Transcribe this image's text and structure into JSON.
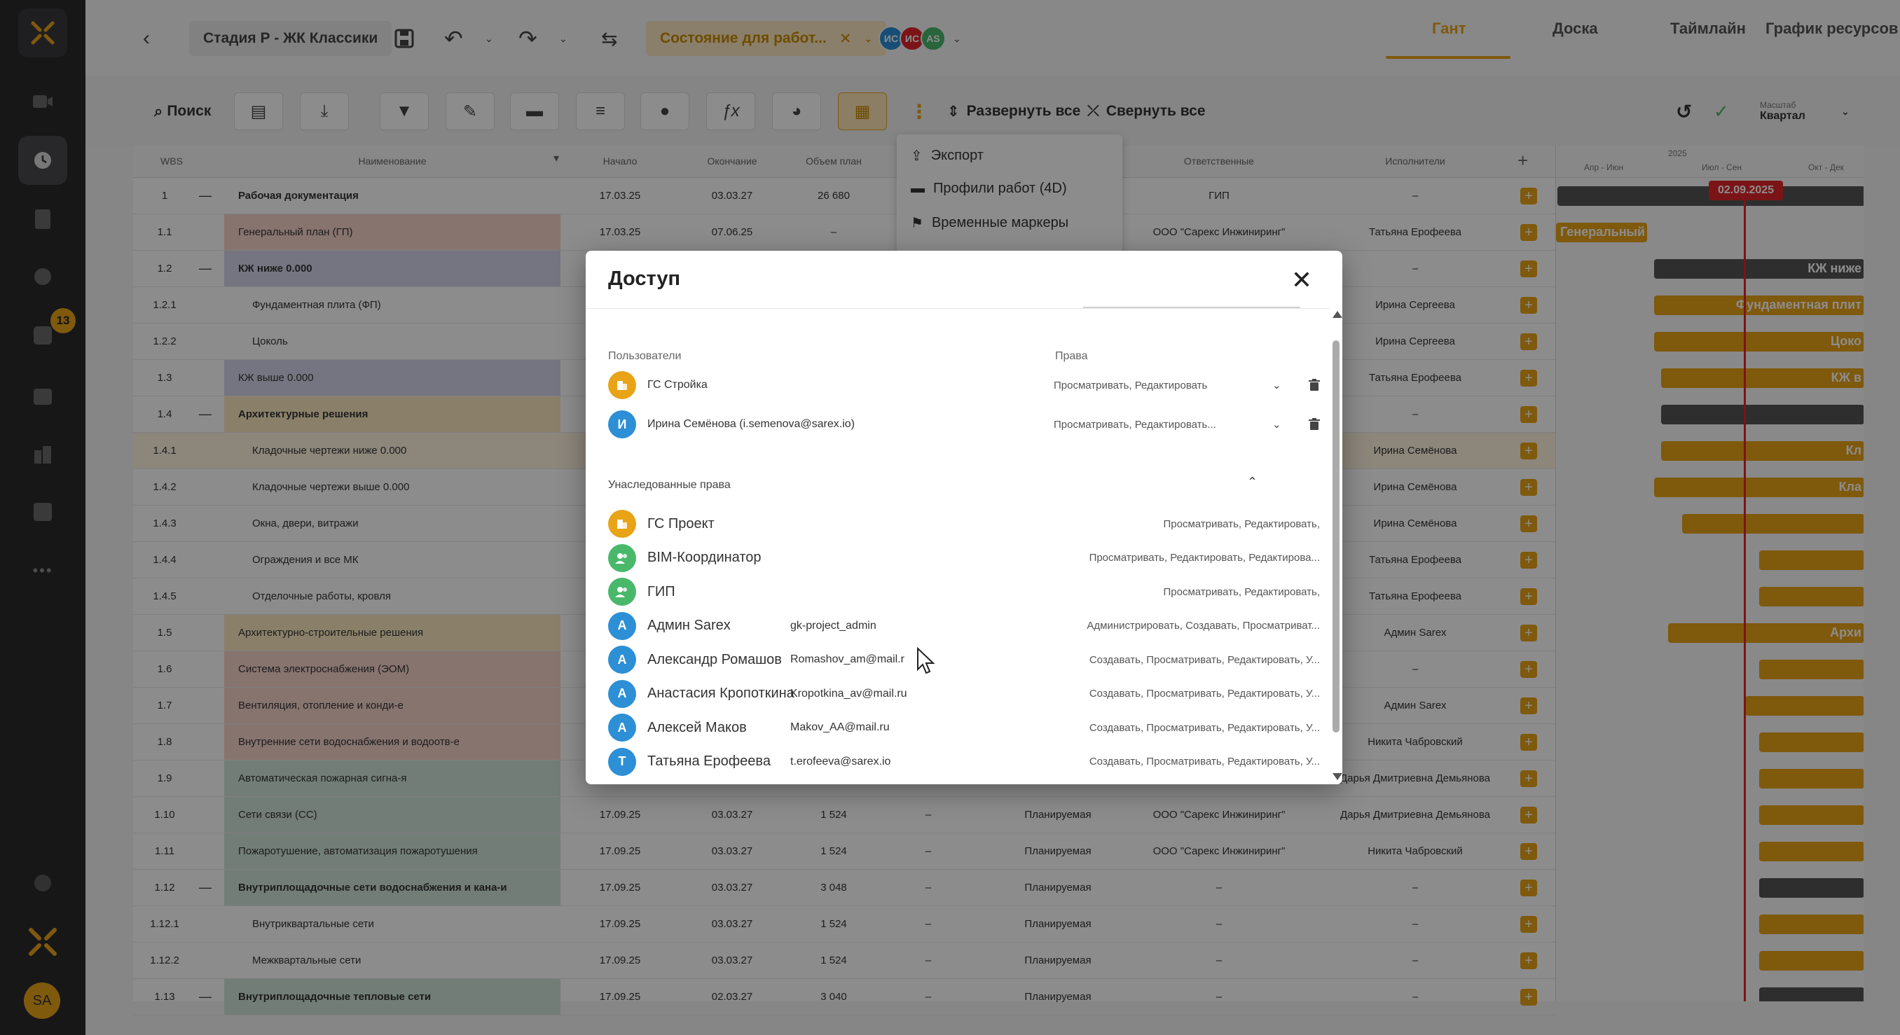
{
  "sidebar": {
    "badge": "13",
    "avatar": "SA"
  },
  "header": {
    "back_icon": "chevron-left-icon",
    "stage": "Стадия Р - ЖК Классики",
    "state_filter": "Состояние для работ...",
    "avatars": [
      {
        "initials": "ИС",
        "color": "#2d8fd5"
      },
      {
        "initials": "ИС",
        "color": "#e0262b"
      },
      {
        "initials": "AS",
        "color": "#49b86a"
      }
    ],
    "tabs": [
      "Гант",
      "Доска",
      "Таймлайн",
      "График ресурсов"
    ]
  },
  "toolbar": {
    "search": "Поиск",
    "expand_all": "Развернуть все",
    "collapse_all": "Свернуть все",
    "scale_label": "Масштаб",
    "scale_value": "Квартал"
  },
  "grid": {
    "headers": {
      "wbs": "WBS",
      "name": "Наименование",
      "start": "Начало",
      "end": "Окончание",
      "volume": "Объем план",
      "responsible": "Ответственные",
      "executor": "Исполнители"
    },
    "rows": [
      {
        "wbs": "1",
        "name": "Рабочая документация",
        "start": "17.03.25",
        "end": "03.03.27",
        "vol": "26 680",
        "status": "",
        "resp": "ГИП",
        "exec": "–"
      },
      {
        "wbs": "1.1",
        "name": "Генеральный план (ГП)",
        "start": "17.03.25",
        "end": "07.06.25",
        "vol": "–",
        "status": "",
        "resp": "ООО \"Сарекс Инжиниринг\"",
        "exec": "Татьяна Ерофеева"
      },
      {
        "wbs": "1.2",
        "name": "КЖ ниже 0.000",
        "start": "",
        "end": "",
        "vol": "",
        "status": "",
        "resp": "",
        "exec": "–"
      },
      {
        "wbs": "1.2.1",
        "name": "Фундаментная плита (ФП)",
        "start": "",
        "end": "",
        "vol": "",
        "status": "",
        "resp": "",
        "exec": "Ирина Сергеева"
      },
      {
        "wbs": "1.2.2",
        "name": "Цоколь",
        "start": "",
        "end": "",
        "vol": "",
        "status": "",
        "resp": "",
        "exec": "Ирина Сергеева"
      },
      {
        "wbs": "1.3",
        "name": "КЖ выше 0.000",
        "start": "",
        "end": "",
        "vol": "",
        "status": "",
        "resp": "",
        "exec": "Татьяна Ерофеева"
      },
      {
        "wbs": "1.4",
        "name": "Архитектурные решения",
        "start": "",
        "end": "",
        "vol": "",
        "status": "",
        "resp": "",
        "exec": "–"
      },
      {
        "wbs": "1.4.1",
        "name": "Кладочные чертежи ниже 0.000",
        "start": "",
        "end": "",
        "vol": "",
        "status": "",
        "resp": "",
        "exec": "Ирина Семёнова"
      },
      {
        "wbs": "1.4.2",
        "name": "Кладочные чертежи выше 0.000",
        "start": "",
        "end": "",
        "vol": "",
        "status": "",
        "resp": "",
        "exec": "Ирина Семёнова"
      },
      {
        "wbs": "1.4.3",
        "name": "Окна, двери, витражи",
        "start": "",
        "end": "",
        "vol": "",
        "status": "",
        "resp": "",
        "exec": "Ирина Семёнова"
      },
      {
        "wbs": "1.4.4",
        "name": "Ограждения и все МК",
        "start": "",
        "end": "",
        "vol": "",
        "status": "",
        "resp": "",
        "exec": "Татьяна Ерофеева"
      },
      {
        "wbs": "1.4.5",
        "name": "Отделочные работы, кровля",
        "start": "",
        "end": "",
        "vol": "",
        "status": "",
        "resp": "",
        "exec": "Татьяна Ерофеева"
      },
      {
        "wbs": "1.5",
        "name": "Архитектурно-строительные решения",
        "start": "",
        "end": "",
        "vol": "",
        "status": "",
        "resp": "",
        "exec": "Админ Sarex"
      },
      {
        "wbs": "1.6",
        "name": "Система электроснабжения (ЭОМ)",
        "start": "",
        "end": "",
        "vol": "",
        "status": "",
        "resp": "",
        "exec": "–"
      },
      {
        "wbs": "1.7",
        "name": "Вентиляция, отопление и конди-е",
        "start": "",
        "end": "",
        "vol": "",
        "status": "",
        "resp": "",
        "exec": "Админ Sarex"
      },
      {
        "wbs": "1.8",
        "name": "Внутренние сети водоснабжения и водоотв-е",
        "start": "",
        "end": "",
        "vol": "",
        "status": "",
        "resp": "",
        "exec": "Никита Чабровский"
      },
      {
        "wbs": "1.9",
        "name": "Автоматическая пожарная сигна-я",
        "start": "",
        "end": "",
        "vol": "",
        "status": "",
        "resp": "",
        "exec": "Дарья Дмитриевна Демьянова"
      },
      {
        "wbs": "1.10",
        "name": "Сети связи (СС)",
        "start": "17.09.25",
        "end": "03.03.27",
        "vol": "1 524",
        "status": "Планируемая",
        "resp": "ООО \"Сарекс Инжиниринг\"",
        "exec": "Дарья Дмитриевна Демьянова"
      },
      {
        "wbs": "1.11",
        "name": "Пожаротушение, автоматизация пожаротушения",
        "start": "17.09.25",
        "end": "03.03.27",
        "vol": "1 524",
        "status": "Планируемая",
        "resp": "ООО \"Сарекс Инжиниринг\"",
        "exec": "Никита Чабровский"
      },
      {
        "wbs": "1.12",
        "name": "Внутриплощадочные сети водоснабжения и кана-и",
        "start": "17.09.25",
        "end": "03.03.27",
        "vol": "3 048",
        "status": "Планируемая",
        "resp": "–",
        "exec": "–"
      },
      {
        "wbs": "1.12.1",
        "name": "Внутриквартальные сети",
        "start": "17.09.25",
        "end": "03.03.27",
        "vol": "1 524",
        "status": "Планируемая",
        "resp": "–",
        "exec": "–"
      },
      {
        "wbs": "1.12.2",
        "name": "Межквартальные сети",
        "start": "17.09.25",
        "end": "03.03.27",
        "vol": "1 524",
        "status": "Планируемая",
        "resp": "–",
        "exec": "–"
      },
      {
        "wbs": "1.13",
        "name": "Внутриплощадочные тепловые сети",
        "start": "17.09.25",
        "end": "02.03.27",
        "vol": "3 040",
        "status": "Планируемая",
        "resp": "–",
        "exec": "–"
      }
    ]
  },
  "gantt": {
    "year": "2025",
    "quarters": [
      "Апр - Июн",
      "Июл - Сен",
      "Окт - Дек"
    ],
    "today": "02.09.2025",
    "bar_labels": [
      "Генеральный",
      "КЖ ниже",
      "Фундаментная плит",
      "Цоко",
      "КЖ в",
      "Кл",
      "Кла",
      "Архи"
    ]
  },
  "dropdown_menu": {
    "items": [
      "Экспорт",
      "Профили работ (4D)",
      "Временные маркеры"
    ]
  },
  "modal": {
    "title": "Доступ",
    "users_header": "Пользователи",
    "rights_header": "Права",
    "users": [
      {
        "name": "ГС Стройка",
        "icon": "building-icon",
        "initial": "",
        "color": "orange",
        "rights": "Просматривать, Редактировать"
      },
      {
        "name": "Ирина Семёнова (i.semenova@sarex.io)",
        "icon": "user-icon",
        "initial": "И",
        "color": "blue",
        "rights": "Просматривать, Редактировать..."
      }
    ],
    "inherited_title": "Унаследованные права",
    "inherited": [
      {
        "name": "ГС Проект",
        "icon": "building-icon",
        "initial": "",
        "color": "orange",
        "login": "",
        "rights": "Просматривать, Редактировать,"
      },
      {
        "name": "BIM-Координатор",
        "icon": "group-icon",
        "initial": "",
        "color": "green",
        "login": "",
        "rights": "Просматривать, Редактировать, Редактирова..."
      },
      {
        "name": "ГИП",
        "icon": "group-icon",
        "initial": "",
        "color": "green",
        "login": "",
        "rights": "Просматривать, Редактировать,"
      },
      {
        "name": "Админ Sarex",
        "icon": "user-icon",
        "initial": "A",
        "color": "blue",
        "login": "gk-project_admin",
        "rights": "Администрировать, Создавать, Просматриват..."
      },
      {
        "name": "Александр Ромашов",
        "icon": "user-icon",
        "initial": "A",
        "color": "blue",
        "login": "Romashov_am@mail.r",
        "rights": "Создавать, Просматривать, Редактировать, У..."
      },
      {
        "name": "Анастасия Кропоткина",
        "icon": "user-icon",
        "initial": "A",
        "color": "blue",
        "login": "Kropotkina_av@mail.ru",
        "rights": "Создавать, Просматривать, Редактировать, У..."
      },
      {
        "name": "Алексей Маков",
        "icon": "user-icon",
        "initial": "A",
        "color": "blue",
        "login": "Makov_AA@mail.ru",
        "rights": "Создавать, Просматривать, Редактировать, У..."
      },
      {
        "name": "Татьяна Ерофеева",
        "icon": "user-icon",
        "initial": "T",
        "color": "blue",
        "login": "t.erofeeva@sarex.io",
        "rights": "Создавать, Просматривать, Редактировать, У..."
      }
    ]
  },
  "colors": {
    "accent": "#e8a317",
    "today": "#e0262b",
    "sidebar": "#2b2b2d"
  }
}
